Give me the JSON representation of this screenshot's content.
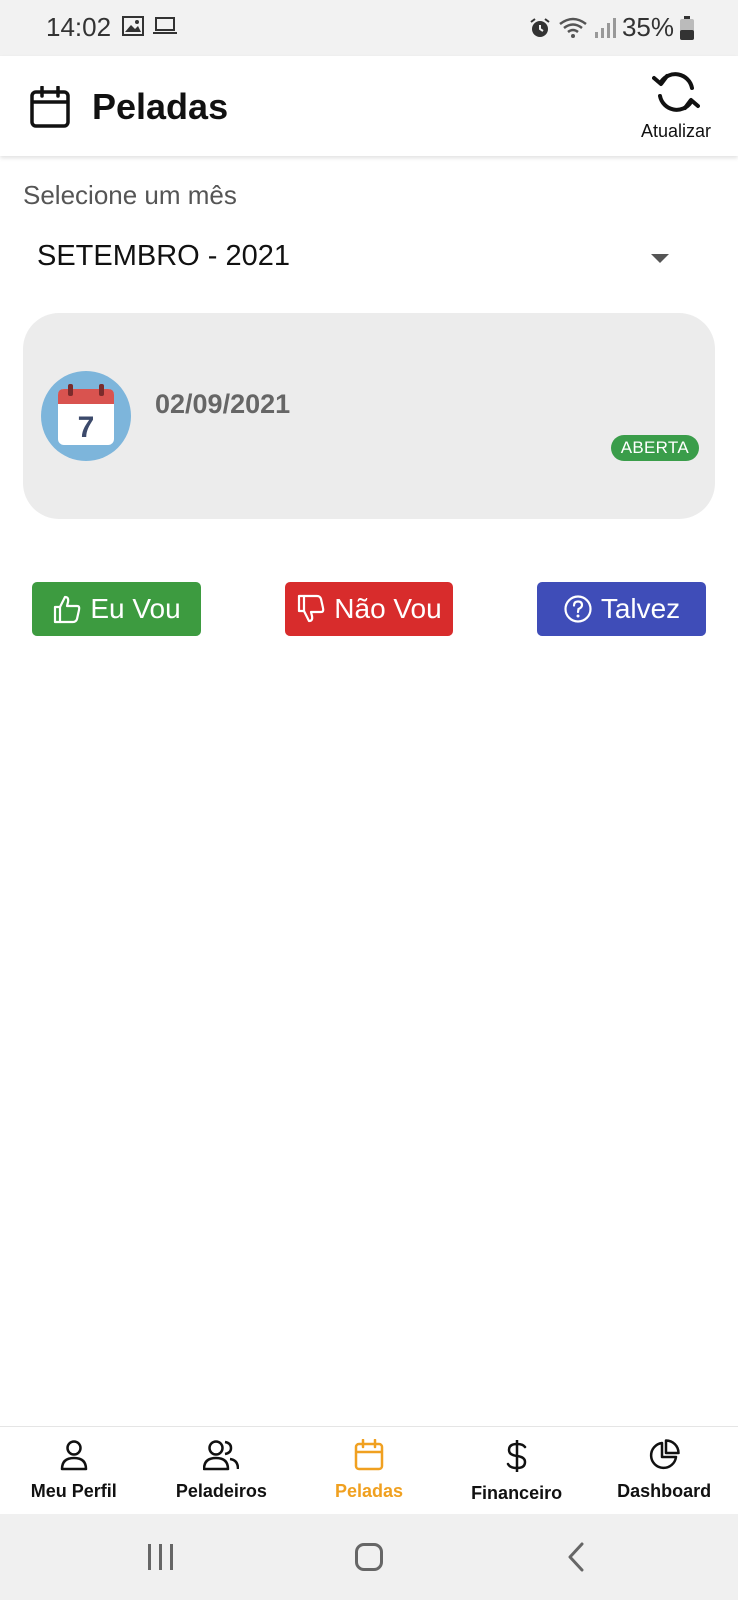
{
  "status_bar": {
    "time": "14:02",
    "battery": "35%",
    "icons": [
      "image-icon",
      "laptop-icon",
      "alarm-icon",
      "wifi-icon",
      "signal-icon",
      "battery-icon"
    ]
  },
  "header": {
    "title": "Peladas",
    "refresh_label": "Atualizar"
  },
  "month_select": {
    "label": "Selecione um mês",
    "value": "SETEMBRO - 2021"
  },
  "event_card": {
    "date": "02/09/2021",
    "calendar_day": "7",
    "status": "ABERTA"
  },
  "actions": {
    "yes": "Eu Vou",
    "no": "Não Vou",
    "maybe": "Talvez"
  },
  "bottom_nav": [
    {
      "label": "Meu Perfil",
      "icon": "user-icon",
      "active": false
    },
    {
      "label": "Peladeiros",
      "icon": "users-icon",
      "active": false
    },
    {
      "label": "Peladas",
      "icon": "calendar-icon",
      "active": true
    },
    {
      "label": "Financeiro",
      "icon": "dollar-icon",
      "active": false
    },
    {
      "label": "Dashboard",
      "icon": "pie-chart-icon",
      "active": false
    }
  ],
  "colors": {
    "accent": "#f0a020",
    "yes": "#3d9b40",
    "no": "#d82c2c",
    "maybe": "#3f4db8",
    "badge": "#3a9d4a",
    "card_bg": "#ececec"
  }
}
